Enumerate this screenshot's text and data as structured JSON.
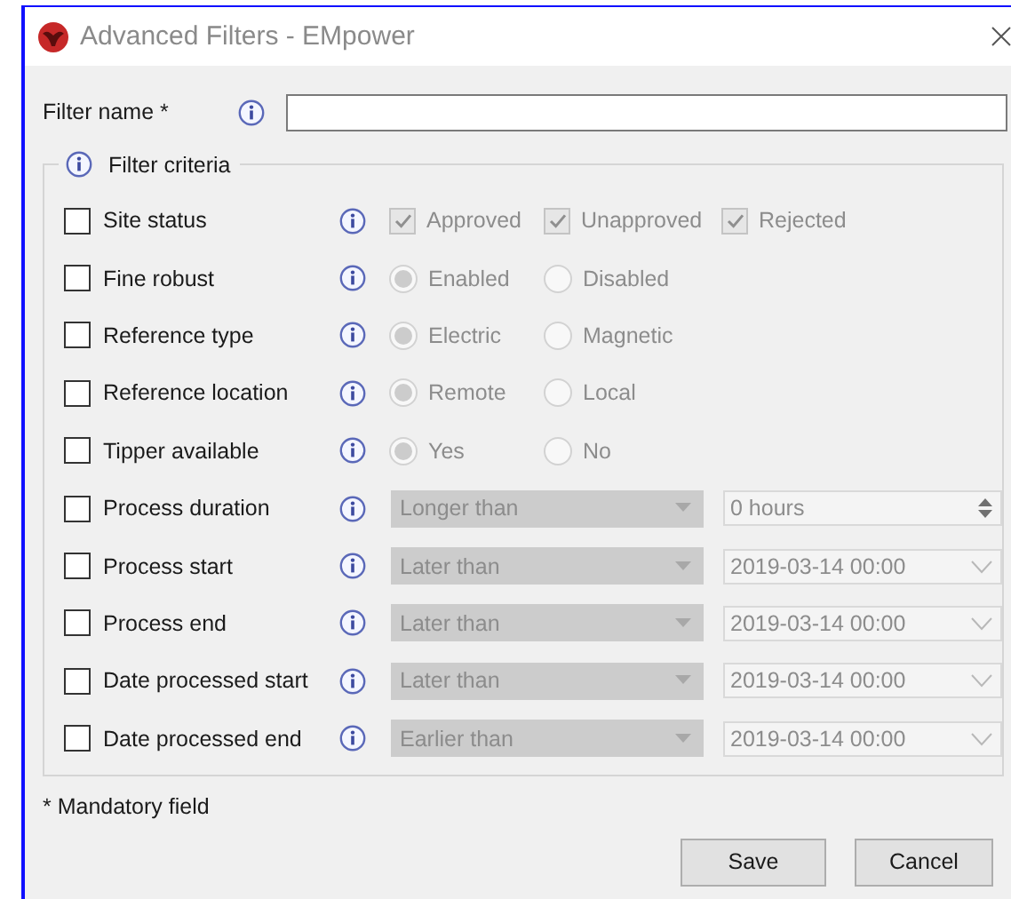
{
  "window": {
    "title": "Advanced Filters - EMpower"
  },
  "filter_name": {
    "label": "Filter name *"
  },
  "criteria": {
    "title": "Filter criteria",
    "rows": [
      {
        "kind": "checks",
        "label": "Site status",
        "checked": false,
        "disabled": true,
        "options": [
          {
            "label": "Approved",
            "checked": true
          },
          {
            "label": "Unapproved",
            "checked": true
          },
          {
            "label": "Rejected",
            "checked": true
          }
        ]
      },
      {
        "kind": "radios",
        "label": "Fine robust",
        "checked": false,
        "disabled": true,
        "options": [
          {
            "label": "Enabled",
            "selected": true
          },
          {
            "label": "Disabled",
            "selected": false
          }
        ]
      },
      {
        "kind": "radios",
        "label": "Reference type",
        "checked": false,
        "disabled": true,
        "options": [
          {
            "label": "Electric",
            "selected": true
          },
          {
            "label": "Magnetic",
            "selected": false
          }
        ]
      },
      {
        "kind": "radios",
        "label": "Reference location",
        "checked": false,
        "disabled": true,
        "options": [
          {
            "label": "Remote",
            "selected": true
          },
          {
            "label": "Local",
            "selected": false
          }
        ]
      },
      {
        "kind": "radios",
        "label": "Tipper available",
        "checked": false,
        "disabled": true,
        "options": [
          {
            "label": "Yes",
            "selected": true
          },
          {
            "label": "No",
            "selected": false
          }
        ]
      },
      {
        "kind": "spin",
        "label": "Process duration",
        "checked": false,
        "disabled": true,
        "operator": "Longer than",
        "value": "0 hours"
      },
      {
        "kind": "date",
        "label": "Process start",
        "checked": false,
        "disabled": true,
        "operator": "Later than",
        "value": "2019-03-14 00:00"
      },
      {
        "kind": "date",
        "label": "Process end",
        "checked": false,
        "disabled": true,
        "operator": "Later than",
        "value": "2019-03-14 00:00"
      },
      {
        "kind": "date",
        "label": "Date processed start",
        "checked": false,
        "disabled": true,
        "operator": "Later than",
        "value": "2019-03-14 00:00"
      },
      {
        "kind": "date",
        "label": "Date processed end",
        "checked": false,
        "disabled": true,
        "operator": "Earlier than",
        "value": "2019-03-14 00:00"
      }
    ]
  },
  "footnote": "* Mandatory field",
  "buttons": [
    "Save",
    "Cancel"
  ]
}
